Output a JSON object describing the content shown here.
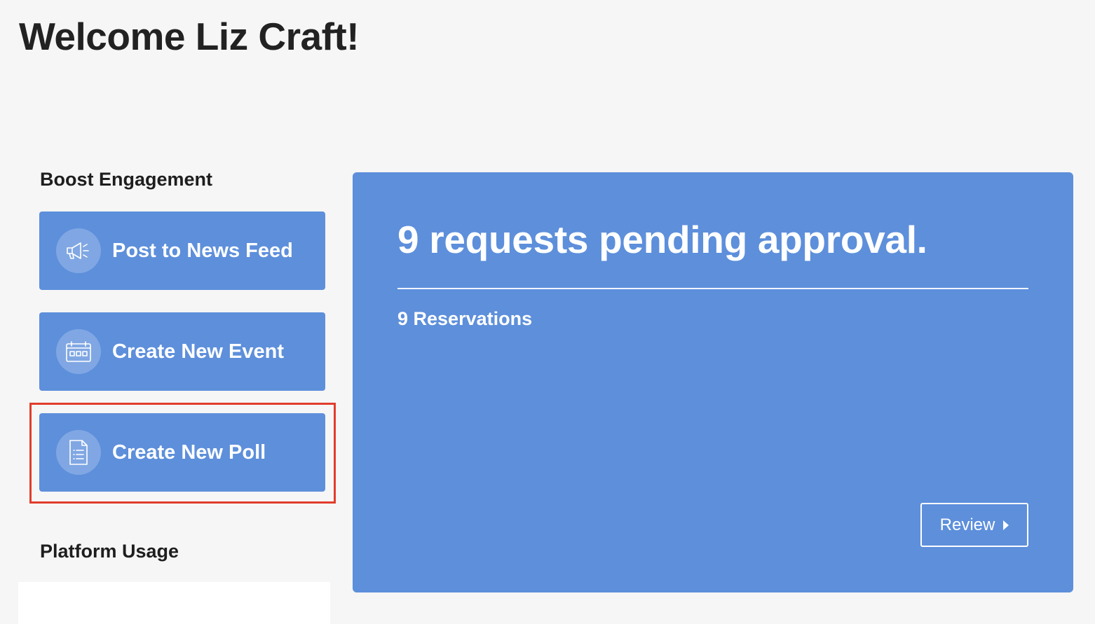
{
  "header": {
    "welcome": "Welcome Liz Craft!"
  },
  "boost": {
    "heading": "Boost Engagement",
    "actions": [
      {
        "label": "Post to News Feed",
        "icon": "megaphone-icon"
      },
      {
        "label": "Create New Event",
        "icon": "calendar-icon"
      },
      {
        "label": "Create New Poll",
        "icon": "poll-document-icon"
      }
    ]
  },
  "usage": {
    "heading": "Platform Usage"
  },
  "pending": {
    "title": "9 requests pending approval.",
    "reservations": "9 Reservations",
    "review_label": "Review"
  },
  "colors": {
    "page_background": "#f6f6f6",
    "accent_blue": "#5d8fdb",
    "highlight_red": "#e23d2c",
    "text_white": "#ffffff",
    "text_dark": "#222222"
  }
}
